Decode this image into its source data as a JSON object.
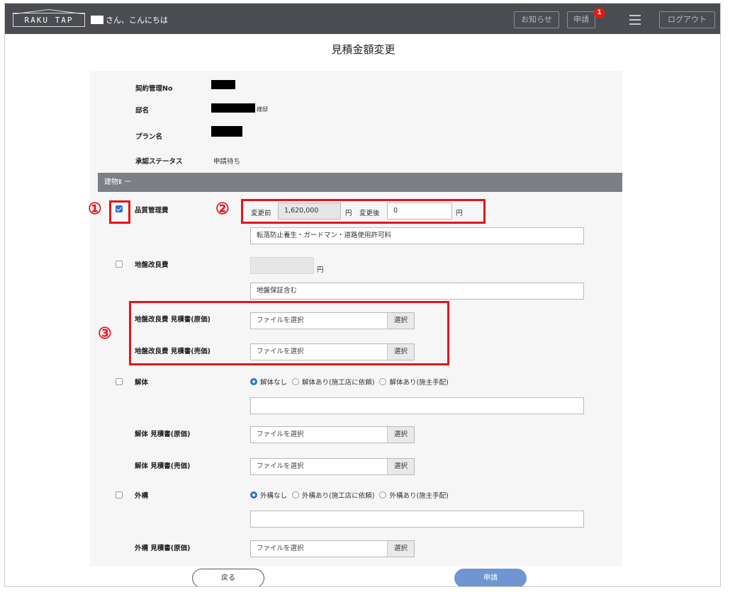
{
  "header": {
    "logo": "RAKU TAP",
    "greeting": "さん、こんにちは",
    "news_label": "お知らせ",
    "apply_label": "申請",
    "apply_badge": "1",
    "logout_label": "ログアウト"
  },
  "page_title": "見積金額変更",
  "info": {
    "contract_no_label": "契約管理No",
    "site_label": "邸名",
    "site_suffix": "様邸",
    "plan_label": "プラン名",
    "status_label": "承認ステータス",
    "status_value": "申請待ち"
  },
  "section": {
    "title": "建物Ⅱ ー"
  },
  "quality_fee": {
    "label": "品質管理費",
    "checked": true,
    "before_label": "変更前",
    "before_value": "1,620,000",
    "yen": "円",
    "after_label": "変更後",
    "after_value": "0",
    "note": "転落防止養生・ガードマン・道路使用許可料"
  },
  "ground_fee": {
    "label": "地盤改良費",
    "checked": false,
    "yen": "円",
    "note": "地盤保証含む",
    "estimate_cost_label": "地盤改良費 見積書(原価)",
    "estimate_sale_label": "地盤改良費 見積書(売価)"
  },
  "demolition": {
    "label": "解体",
    "checked": false,
    "options": [
      "解体なし",
      "解体あり(施工店に依頼)",
      "解体あり(施主手配)"
    ],
    "selected": 0,
    "estimate_cost_label": "解体 見積書(原価)",
    "estimate_sale_label": "解体 見積書(売価)"
  },
  "exterior": {
    "label": "外構",
    "checked": false,
    "options": [
      "外構なし",
      "外構あり(施工店に依頼)",
      "外構あり(施主手配)"
    ],
    "selected": 0,
    "estimate_cost_label": "外構 見積書(原価)"
  },
  "file": {
    "placeholder": "ファイルを選択",
    "button": "選択"
  },
  "annotations": [
    "①",
    "②",
    "③"
  ],
  "footer": {
    "back_label": "戻る",
    "submit_label": "申請"
  },
  "colors": {
    "header_bg": "#4a4c52",
    "section_bg": "#7c7f85",
    "accent_blue": "#2f6fd6",
    "submit_bg": "#6f96d3",
    "annotation_red": "#e3151b",
    "badge_red": "#e8190f"
  }
}
